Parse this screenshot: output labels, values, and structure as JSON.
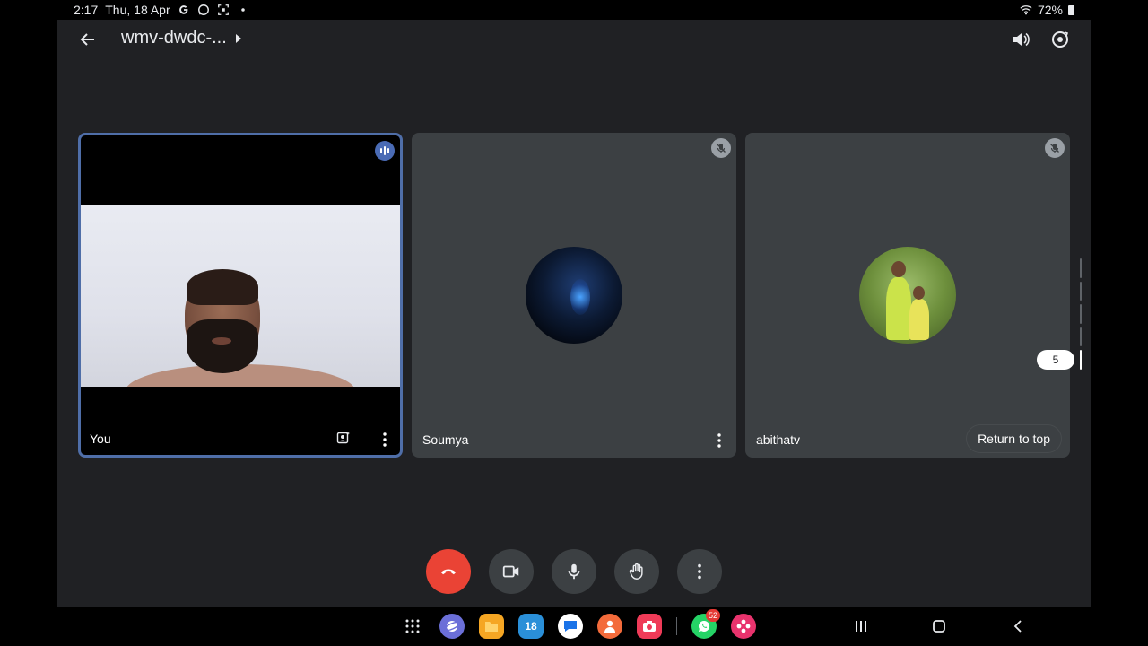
{
  "status_bar": {
    "time": "2:17",
    "date": "Thu, 18 Apr",
    "battery": "72%",
    "notification_icons": [
      "google-icon",
      "whatsapp-icon",
      "screenshot-icon",
      "dot-icon"
    ]
  },
  "header": {
    "meeting_title": "wmv-dwdc-...",
    "icons": [
      "back-arrow-icon",
      "speaker-icon",
      "switch-camera-icon"
    ]
  },
  "participants": [
    {
      "name": "You",
      "video_on": true,
      "speaking": true
    },
    {
      "name": "Soumya",
      "video_on": false,
      "muted": true
    },
    {
      "name": "abithatv",
      "video_on": false,
      "muted": true
    }
  ],
  "return_to_top_label": "Return to top",
  "page_indicator": {
    "count_label": "5",
    "total_pages": 5,
    "active_page": 5
  },
  "controls": [
    "end-call-icon",
    "camera-icon",
    "microphone-icon",
    "raise-hand-icon",
    "more-options-icon"
  ],
  "dock": {
    "apps": [
      "app-drawer-icon",
      "internet-browser-icon",
      "my-files-icon",
      "calendar-icon",
      "messages-icon",
      "contacts-icon",
      "camera-app-icon"
    ],
    "calendar_day": "18",
    "recent_apps": [
      "whatsapp-icon",
      "gallery-icon"
    ],
    "whatsapp_badge": "52"
  },
  "colors": {
    "background": "#202124",
    "tile": "#3c4043",
    "end_call": "#ea4335",
    "active_tile_border": "#4f6ea8"
  }
}
